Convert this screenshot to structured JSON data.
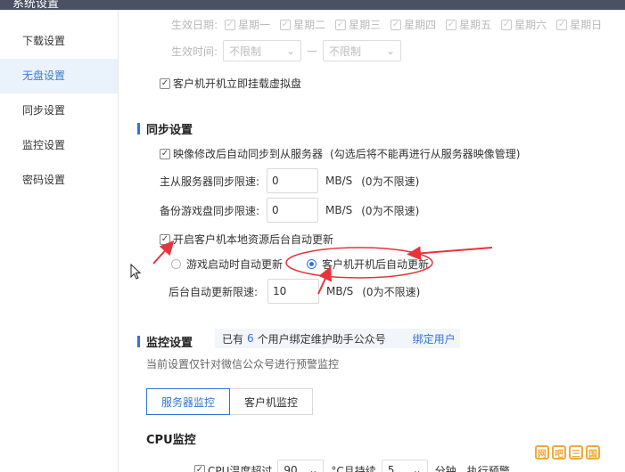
{
  "window": {
    "title": "系统设置"
  },
  "sidebar": {
    "items": [
      {
        "label": "下载设置"
      },
      {
        "label": "无盘设置"
      },
      {
        "label": "同步设置"
      },
      {
        "label": "监控设置"
      },
      {
        "label": "密码设置"
      }
    ]
  },
  "schedule": {
    "date_label": "生效日期:",
    "days": [
      "星期一",
      "星期二",
      "星期三",
      "星期四",
      "星期五",
      "星期六",
      "星期日"
    ],
    "time_label": "生效时间:",
    "time_start": "不限制",
    "time_sep": "—",
    "time_end": "不限制"
  },
  "mount_on_boot": {
    "label": "客户机开机立即挂载虚拟盘"
  },
  "sync": {
    "title": "同步设置",
    "image_sync": {
      "label": "映像修改后自动同步到从服务器",
      "hint": "(勾选后将不能再进行从服务器映像管理)"
    },
    "master_slave": {
      "label": "主从服务器同步限速:",
      "value": "0",
      "unit": "MB/S",
      "hint": "(0为不限速)"
    },
    "backup_disk": {
      "label": "备份游戏盘同步限速:",
      "value": "0",
      "unit": "MB/S",
      "hint": "(0为不限速)"
    },
    "local_update": {
      "label": "开启客户机本地资源后台自动更新"
    },
    "radio_game_start": {
      "label": "游戏启动时自动更新"
    },
    "radio_client_boot": {
      "label": "客户机开机后自动更新"
    },
    "bg_update": {
      "label": "后台自动更新限速:",
      "value": "10",
      "unit": "MB/S",
      "hint": "(0为不限速)"
    }
  },
  "monitor": {
    "title": "监控设置",
    "info_prefix": "已有",
    "info_count": "6",
    "info_suffix": "个用户绑定维护助手公众号",
    "bind_link": "绑定用户",
    "note": "当前设置仅针对微信公众号进行预警监控",
    "tabs": [
      {
        "label": "服务器监控"
      },
      {
        "label": "客户机监控"
      }
    ],
    "cpu_title": "CPU监控",
    "cpu_temp": {
      "label": "CPU温度超过",
      "value": "90",
      "unit": "°C且持续",
      "duration": "5",
      "after": "分钟，执行预警"
    }
  },
  "watermark": {
    "chars": [
      "网",
      "吧",
      "三",
      "国"
    ]
  },
  "colors": {
    "accent": "#2f74d8",
    "annotation": "#e8333a",
    "titlebar": "#4a5163"
  }
}
